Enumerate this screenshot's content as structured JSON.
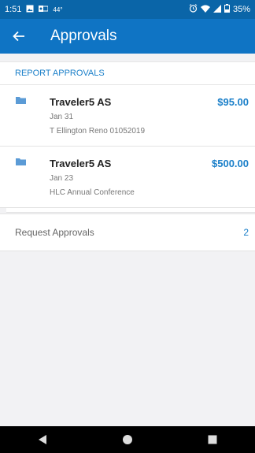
{
  "status_bar": {
    "time": "1:51",
    "temp": "44°",
    "battery": "35%"
  },
  "app_bar": {
    "title": "Approvals"
  },
  "section": {
    "header": "REPORT APPROVALS"
  },
  "reports": [
    {
      "name": "Traveler5 AS",
      "date": "Jan 31",
      "description": "T Ellington Reno 01052019",
      "amount": "$95.00"
    },
    {
      "name": "Traveler5 AS",
      "date": "Jan 23",
      "description": "HLC Annual Conference",
      "amount": "$500.00"
    }
  ],
  "request_approvals": {
    "label": "Request Approvals",
    "count": "2"
  },
  "colors": {
    "status_bar": "#0a65a8",
    "app_bar": "#0f74c4",
    "accent": "#1a7fc9",
    "background": "#f2f2f4"
  }
}
